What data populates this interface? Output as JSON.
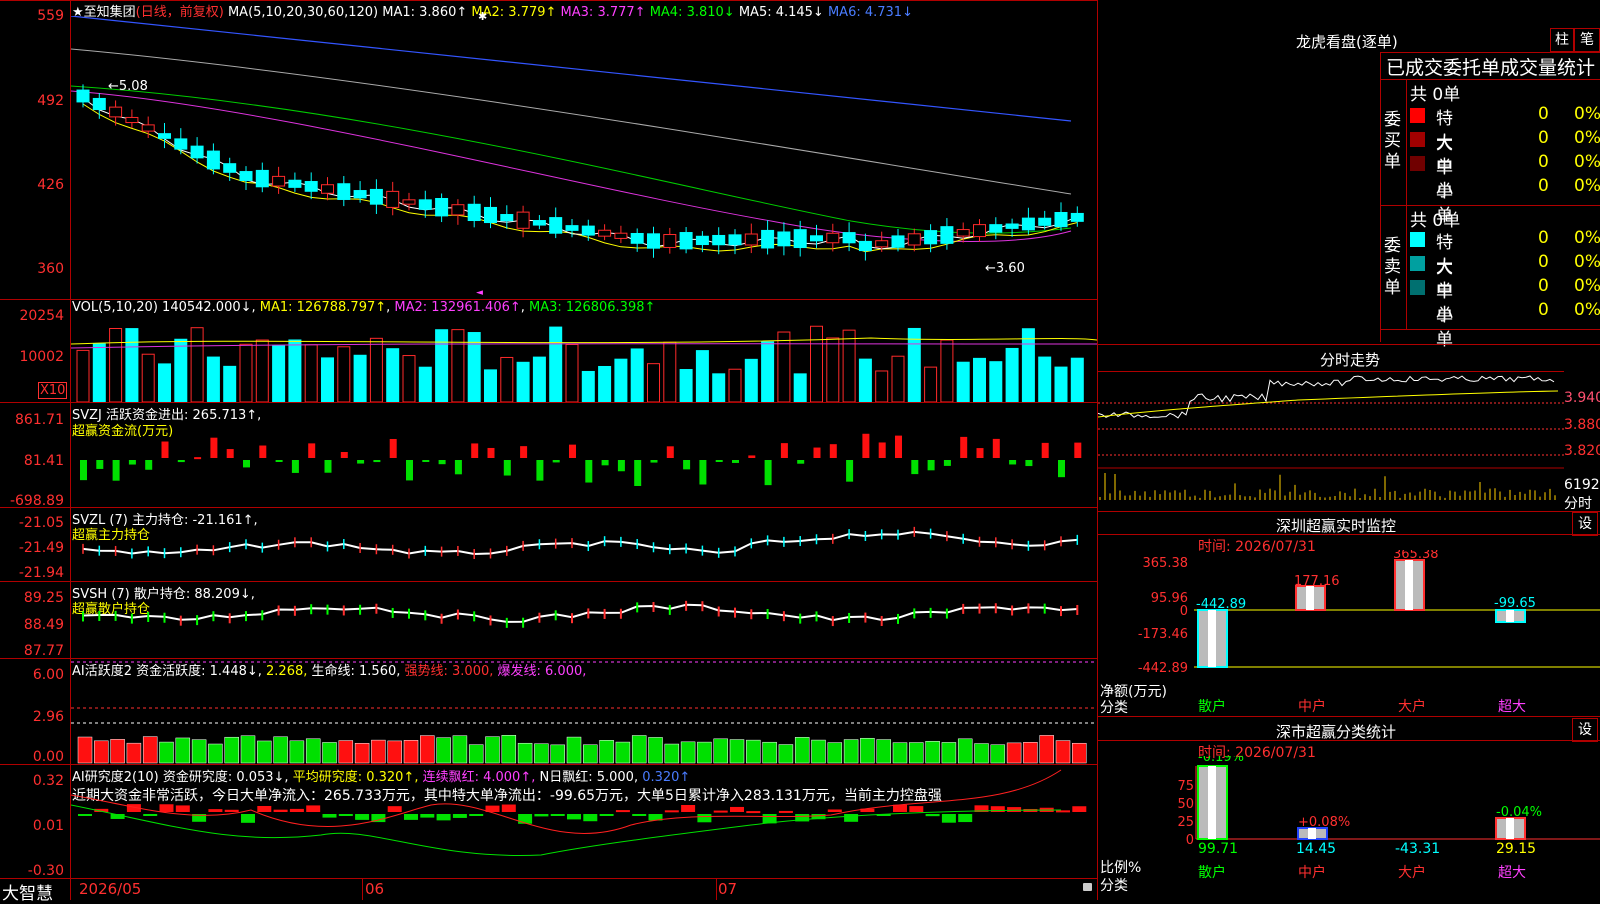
{
  "stock": {
    "name": "★至知集团",
    "mode": "(日线，前复权)",
    "ma_header": "MA(5,10,20,30,60,120)",
    "ma": [
      {
        "label": "MA1:",
        "value": "3.860↑",
        "color": "#ffffff"
      },
      {
        "label": "MA2:",
        "value": "3.779↑",
        "color": "#ffff00"
      },
      {
        "label": "MA3:",
        "value": "3.777↑",
        "color": "#ff40ff"
      },
      {
        "label": "MA4:",
        "value": "3.810↓",
        "color": "#00ff00"
      },
      {
        "label": "MA5:",
        "value": "4.145↓",
        "color": "#ffffff"
      },
      {
        "label": "MA6:",
        "value": "4.731↓",
        "color": "#4a7cff"
      }
    ],
    "high_mark": "←5.08",
    "low_mark": "←3.60",
    "price_axis": [
      "559",
      "492",
      "426",
      "360"
    ]
  },
  "vol": {
    "header": "VOL(5,10,20)",
    "value": "140542.000↓",
    "ma1": "MA1: 126788.797↑",
    "ma2": "MA2: 132961.406↑",
    "ma3": "MA3: 126806.398↑",
    "axis": [
      "20254",
      "10002"
    ],
    "unit": "X10"
  },
  "svzj": {
    "header": "SVZJ  活跃资金进出: 265.713↑,",
    "sub": "超赢资金流(万元)",
    "axis": [
      "861.71",
      "81.41",
      "-698.89"
    ]
  },
  "svzl": {
    "header": "SVZL (7) 主力持仓: -21.161↑,",
    "sub": "超赢主力持仓",
    "axis": [
      "-21.05",
      "-21.49",
      "-21.94"
    ]
  },
  "svsh": {
    "header": "SVSH (7) 散户持仓: 88.209↓,",
    "sub": "超赢散户持仓",
    "axis": [
      "89.25",
      "88.49",
      "87.77"
    ]
  },
  "ai_active": {
    "header_a": "AI活跃度2 资金活跃度: 1.448↓, ",
    "header_b": "2.268, ",
    "header_c": "生命线: 1.560, ",
    "header_d": "强势线: 3.000, ",
    "header_e": "爆发线: 6.000,",
    "axis": [
      "6.00",
      "2.96",
      "0.00"
    ]
  },
  "ai_research": {
    "header_a": "AI研究度2(10) 资金研究度: 0.053↓, ",
    "header_b": "平均研究度: 0.320↑, ",
    "header_c": "连续飘红: 4.000↑, ",
    "header_d": "N日飘红: 5.000, ",
    "header_e": "0.320↑",
    "comment": "近期大资金非常活跃，今日大单净流入：265.733万元，其中特大单净流出：-99.65万元，大单5日累计净入283.131万元，当前主力控盘强",
    "axis": [
      "0.32",
      "0.01",
      "-0.30"
    ]
  },
  "xaxis": {
    "brand": "大智慧",
    "labels": [
      "2026/05",
      "06",
      "07"
    ]
  },
  "right": {
    "lhb_title": "龙虎看盘(逐单)",
    "btn1": "柱",
    "btn2": "笔",
    "stats_title": "已成交委托单成交量统计",
    "buy": {
      "side": "委买单",
      "total": "共 0单",
      "rows": [
        {
          "name": "特大",
          "count": "0",
          "pct": "0%",
          "color": "#ff0000"
        },
        {
          "name": "大单",
          "count": "0",
          "pct": "0%",
          "color": "#a00000"
        },
        {
          "name": "中单",
          "count": "0",
          "pct": "0%",
          "color": "#700000"
        },
        {
          "name": "小单",
          "count": "0",
          "pct": "0%",
          "color": "#000000"
        }
      ]
    },
    "sell": {
      "side": "委卖单",
      "total": "共 0单",
      "rows": [
        {
          "name": "特大",
          "count": "0",
          "pct": "0%",
          "color": "#00ffff"
        },
        {
          "name": "大单",
          "count": "0",
          "pct": "0%",
          "color": "#00a0a0"
        },
        {
          "name": "中单",
          "count": "0",
          "pct": "0%",
          "color": "#007070"
        },
        {
          "name": "小单",
          "count": "0",
          "pct": "0%",
          "color": "#000000"
        }
      ]
    },
    "intraday": {
      "title": "分时走势",
      "axis": [
        "3.940",
        "3.880",
        "3.820"
      ],
      "vol_label": "6192",
      "vol_unit": "分时"
    },
    "monitor": {
      "title": "深圳超赢实时监控",
      "btn": "设",
      "time": "时间: 2026/07/31",
      "axis": [
        "365.38",
        "95.96",
        "0",
        "-173.46",
        "-442.89"
      ],
      "unit_a": "净额(万元)",
      "unit_b": "分类",
      "cats": [
        "散户",
        "中户",
        "大户",
        "超大"
      ],
      "values": [
        "-442.89",
        "177.16",
        "365.38",
        "-99.65"
      ]
    },
    "classify": {
      "title": "深市超赢分类统计",
      "btn": "设",
      "time": "时间: 2026/07/31",
      "axis": [
        "75",
        "50",
        "25",
        "0"
      ],
      "unit_a": "比例%",
      "unit_b": "分类",
      "cats": [
        "散户",
        "中户",
        "大户",
        "超大"
      ],
      "top": [
        "-0.19%",
        "+0.08%",
        "",
        "-0.04%"
      ],
      "bottom": [
        "99.71",
        "14.45",
        "-43.31",
        "29.15"
      ]
    }
  }
}
